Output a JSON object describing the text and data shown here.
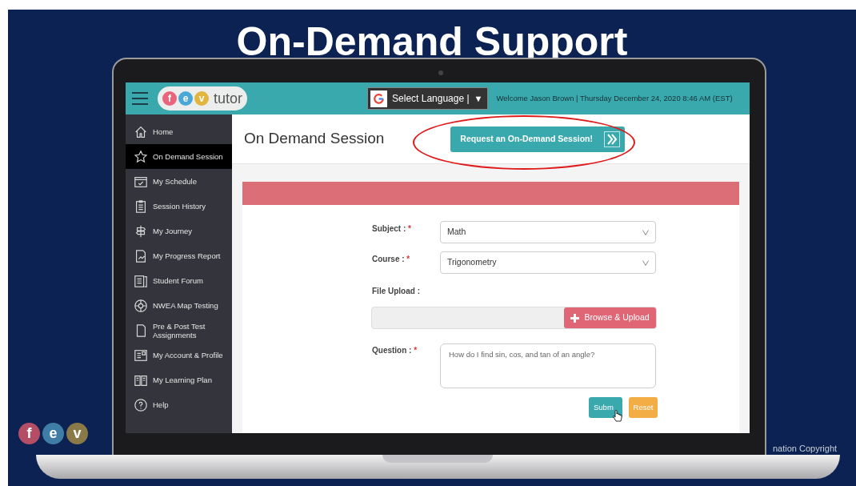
{
  "slide_title": "On-Demand Support",
  "header": {
    "logo_letters": [
      "f",
      "e",
      "v"
    ],
    "logo_word": "tutor",
    "language": "Select Language |",
    "language_caret": "▼",
    "welcome": "Welcome Jason Brown | Thursday December 24, 2020 8:46 AM  (EST)"
  },
  "sidebar": {
    "items": [
      {
        "label": "Home",
        "selected": false
      },
      {
        "label": "On Demand Session",
        "selected": true
      },
      {
        "label": "My Schedule",
        "selected": false
      },
      {
        "label": "Session History",
        "selected": false
      },
      {
        "label": "My Journey",
        "selected": false
      },
      {
        "label": "My Progress Report",
        "selected": false
      },
      {
        "label": "Student Forum",
        "selected": false
      },
      {
        "label": "NWEA Map Testing",
        "selected": false
      },
      {
        "label": "Pre & Post Test Assignments",
        "selected": false
      },
      {
        "label": "My Account & Profile",
        "selected": false
      },
      {
        "label": "My Learning Plan",
        "selected": false
      },
      {
        "label": "Help",
        "selected": false
      }
    ]
  },
  "page_title": "On Demand Session",
  "request_button": "Request an On-Demand Session!",
  "form": {
    "fields": [
      {
        "kind": "select",
        "label": "Subject :",
        "required_mark": "*",
        "value": "Math"
      },
      {
        "kind": "select",
        "label": "Course :",
        "required_mark": "*",
        "value": "Trigonometry"
      },
      {
        "kind": "file",
        "label": "File Upload :",
        "button": "Browse & Upload"
      },
      {
        "kind": "textarea",
        "label": "Question :",
        "required_mark": "*",
        "value": "How do I find sin, cos, and tan of an angle?"
      }
    ],
    "submit": "Subm",
    "reset": "Reset"
  },
  "footer": {
    "logo_letters": [
      "f",
      "e",
      "v"
    ],
    "copyright": "nation Copyright"
  }
}
